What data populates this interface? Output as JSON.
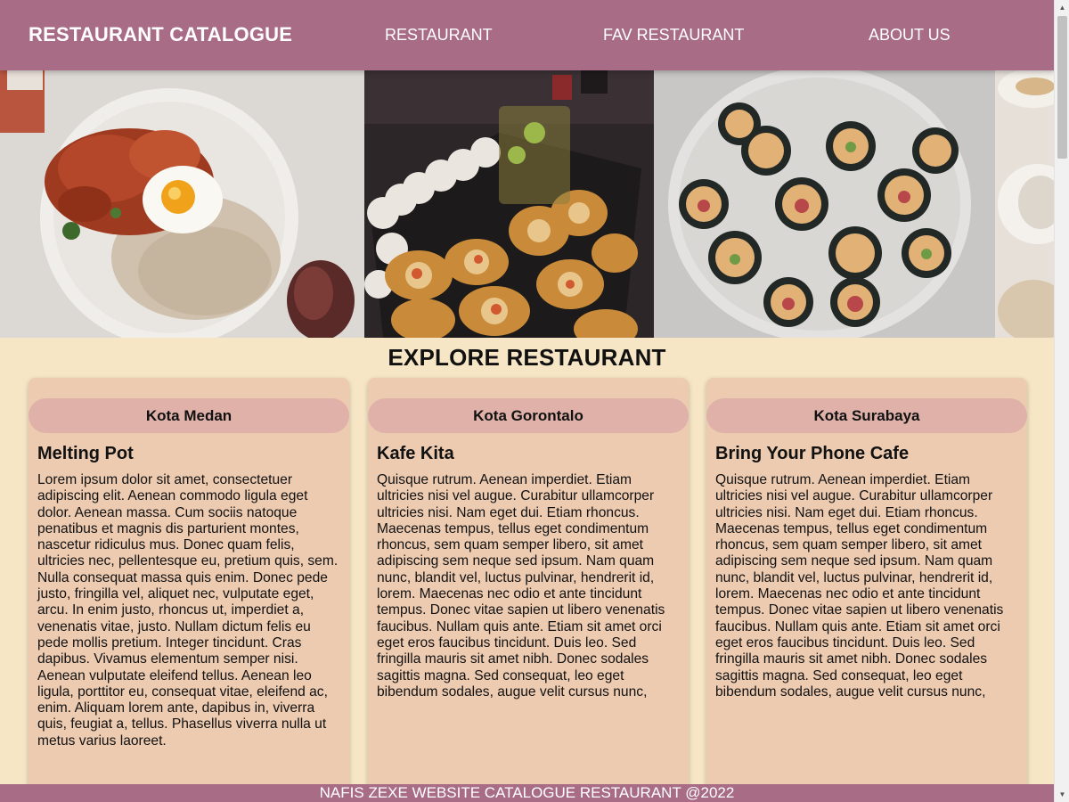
{
  "header": {
    "brand": "RESTAURANT CATALOGUE",
    "nav": [
      "RESTAURANT",
      "FAV RESTAURANT",
      "ABOUT US"
    ]
  },
  "hero": {
    "images": [
      "rice-with-spicy-chicken-and-fried-egg",
      "sushi-platter",
      "kimbap-plate"
    ]
  },
  "main": {
    "title": "EXPLORE RESTAURANT",
    "restaurants": [
      {
        "city": "Kota Medan",
        "name": "Melting Pot",
        "description": "Lorem ipsum dolor sit amet, consectetuer adipiscing elit. Aenean commodo ligula eget dolor. Aenean massa. Cum sociis natoque penatibus et magnis dis parturient montes, nascetur ridiculus mus. Donec quam felis, ultricies nec, pellentesque eu, pretium quis, sem. Nulla consequat massa quis enim. Donec pede justo, fringilla vel, aliquet nec, vulputate eget, arcu. In enim justo, rhoncus ut, imperdiet a, venenatis vitae, justo. Nullam dictum felis eu pede mollis pretium. Integer tincidunt. Cras dapibus. Vivamus elementum semper nisi. Aenean vulputate eleifend tellus. Aenean leo ligula, porttitor eu, consequat vitae, eleifend ac, enim. Aliquam lorem ante, dapibus in, viverra quis, feugiat a, tellus. Phasellus viverra nulla ut metus varius laoreet."
      },
      {
        "city": "Kota Gorontalo",
        "name": "Kafe Kita",
        "description": "Quisque rutrum. Aenean imperdiet. Etiam ultricies nisi vel augue. Curabitur ullamcorper ultricies nisi. Nam eget dui. Etiam rhoncus. Maecenas tempus, tellus eget condimentum rhoncus, sem quam semper libero, sit amet adipiscing sem neque sed ipsum. Nam quam nunc, blandit vel, luctus pulvinar, hendrerit id, lorem. Maecenas nec odio et ante tincidunt tempus. Donec vitae sapien ut libero venenatis faucibus. Nullam quis ante. Etiam sit amet orci eget eros faucibus tincidunt. Duis leo. Sed fringilla mauris sit amet nibh. Donec sodales sagittis magna. Sed consequat, leo eget bibendum sodales, augue velit cursus nunc,"
      },
      {
        "city": "Kota Surabaya",
        "name": "Bring Your Phone Cafe",
        "description": "Quisque rutrum. Aenean imperdiet. Etiam ultricies nisi vel augue. Curabitur ullamcorper ultricies nisi. Nam eget dui. Etiam rhoncus. Maecenas tempus, tellus eget condimentum rhoncus, sem quam semper libero, sit amet adipiscing sem neque sed ipsum. Nam quam nunc, blandit vel, luctus pulvinar, hendrerit id, lorem. Maecenas nec odio et ante tincidunt tempus. Donec vitae sapien ut libero venenatis faucibus. Nullam quis ante. Etiam sit amet orci eget eros faucibus tincidunt. Duis leo. Sed fringilla mauris sit amet nibh. Donec sodales sagittis magna. Sed consequat, leo eget bibendum sodales, augue velit cursus nunc,"
      }
    ]
  },
  "footer": {
    "text": "NAFIS ZEXE WEBSITE CATALOGUE RESTAURANT @2022"
  },
  "colors": {
    "header": "#a86c86",
    "page_background": "#f7e6c6",
    "card": "#edcbb1",
    "city_pill": "#dfb1a9"
  }
}
